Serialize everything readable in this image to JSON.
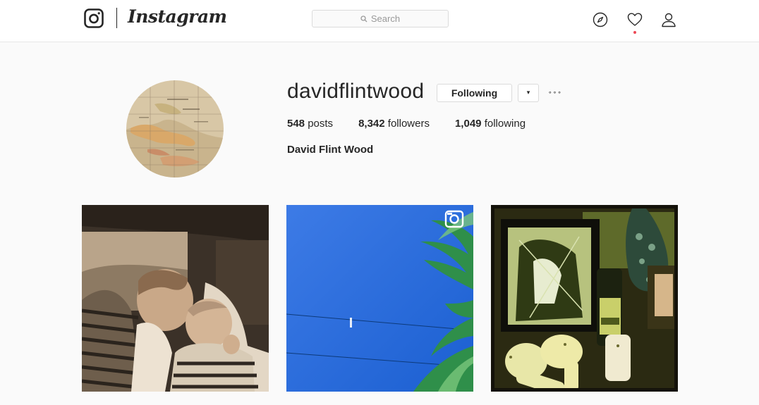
{
  "header": {
    "brand": "Instagram",
    "search_placeholder": "Search",
    "icons": [
      "instagram-glyph-icon",
      "search-icon",
      "compass-icon",
      "heart-icon",
      "user-icon"
    ],
    "notification_color": "#ed4956"
  },
  "profile": {
    "username": "davidflintwood",
    "follow_label": "Following",
    "dropdown_glyph": "▾",
    "options_glyph": "∘∘∘",
    "full_name": "David Flint Wood",
    "stats": {
      "posts_count": "548",
      "posts_label": "posts",
      "followers_count": "8,342",
      "followers_label": "followers",
      "following_count": "1,049",
      "following_label": "following"
    }
  },
  "grid": {
    "posts": [
      {
        "kind": "sepia-photo-mother-and-baby"
      },
      {
        "kind": "blue-sky-palm-leaves",
        "badge": "camera-badge-icon"
      },
      {
        "kind": "green-tinted-still-life"
      }
    ]
  }
}
